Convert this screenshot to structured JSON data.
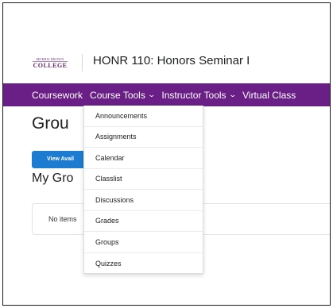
{
  "header": {
    "logo": {
      "line1": "MORRIS BROWN",
      "line2": "COLLEGE"
    },
    "course_title": "HONR 110: Honors Seminar I"
  },
  "navbar": {
    "items": [
      {
        "label": "Coursework",
        "has_menu": false
      },
      {
        "label": "Course Tools",
        "has_menu": true
      },
      {
        "label": "Instructor Tools",
        "has_menu": true
      },
      {
        "label": "Virtual Class",
        "has_menu": false
      }
    ],
    "chevron": "chevron-down-icon"
  },
  "main": {
    "page_title": "Grou",
    "view_button_label": "View Avail",
    "my_groups_heading": "My Gro",
    "empty_message": "No items"
  },
  "dropdown": {
    "items": [
      "Announcements",
      "Assignments",
      "Calendar",
      "Classlist",
      "Discussions",
      "Grades",
      "Groups",
      "Quizzes"
    ]
  },
  "colors": {
    "navbar": "#6a1f86",
    "button": "#1d7cd0",
    "logo": "#6b2a72"
  }
}
